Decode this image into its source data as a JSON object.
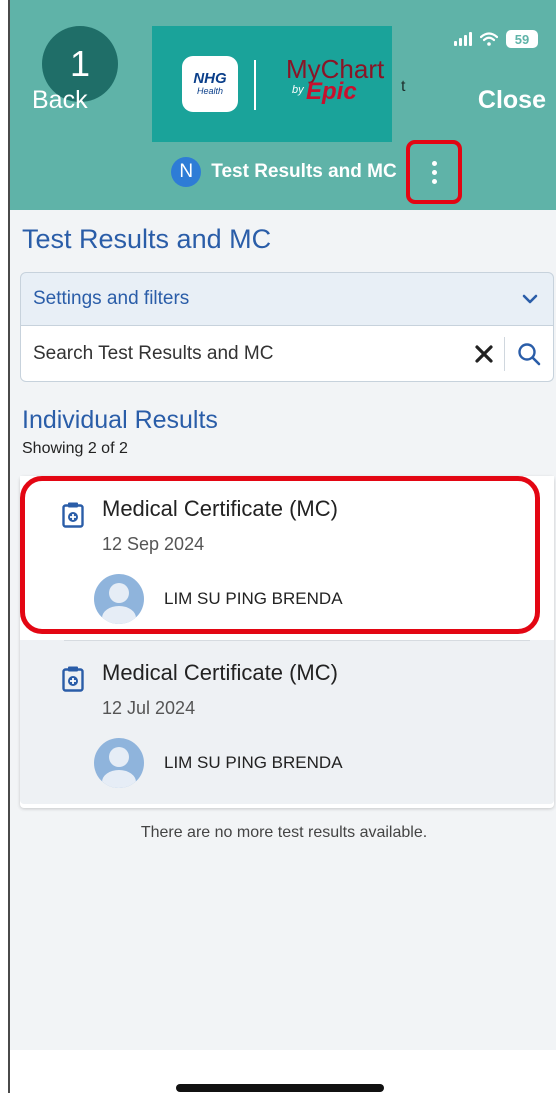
{
  "status_bar": {
    "battery": "59"
  },
  "header": {
    "step_number": "1",
    "back_label": "Back",
    "close_label": "Close",
    "title_fragment": "t",
    "logo": {
      "nhg_name": "NHG",
      "nhg_sub": "Health",
      "mychart_name": "MyChart",
      "mychart_by": "by",
      "mychart_epic": "Epic"
    },
    "patient_initial": "N",
    "patient_title": "Test Results and MC"
  },
  "page": {
    "title": "Test Results and MC",
    "filter_label": "Settings and filters",
    "search_placeholder": "Search Test Results and MC",
    "section_title": "Individual Results",
    "section_count": "Showing 2 of 2",
    "footer_note": "There are no more test results available."
  },
  "results": [
    {
      "title": "Medical Certificate (MC)",
      "date": "12 Sep 2024",
      "provider": "LIM SU PING BRENDA"
    },
    {
      "title": "Medical Certificate (MC)",
      "date": "12 Jul 2024",
      "provider": "LIM SU PING BRENDA"
    }
  ],
  "colors": {
    "header_bg": "#5fb3a8",
    "link_blue": "#2a5da8",
    "highlight_red": "#e30613"
  },
  "icons": [
    "signal-icon",
    "wifi-icon",
    "battery-icon",
    "more-vertical-icon",
    "chevron-down-icon",
    "clear-icon",
    "search-icon",
    "report-icon",
    "avatar-icon"
  ]
}
